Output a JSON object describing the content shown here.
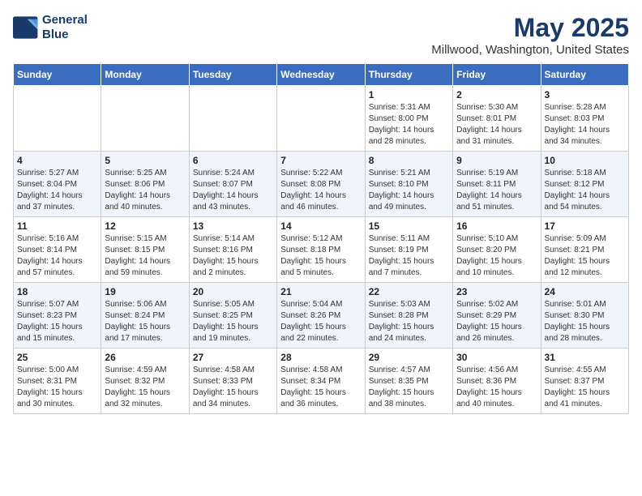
{
  "header": {
    "logo_line1": "General",
    "logo_line2": "Blue",
    "title": "May 2025",
    "subtitle": "Millwood, Washington, United States"
  },
  "weekdays": [
    "Sunday",
    "Monday",
    "Tuesday",
    "Wednesday",
    "Thursday",
    "Friday",
    "Saturday"
  ],
  "weeks": [
    [
      {
        "num": "",
        "detail": ""
      },
      {
        "num": "",
        "detail": ""
      },
      {
        "num": "",
        "detail": ""
      },
      {
        "num": "",
        "detail": ""
      },
      {
        "num": "1",
        "detail": "Sunrise: 5:31 AM\nSunset: 8:00 PM\nDaylight: 14 hours\nand 28 minutes."
      },
      {
        "num": "2",
        "detail": "Sunrise: 5:30 AM\nSunset: 8:01 PM\nDaylight: 14 hours\nand 31 minutes."
      },
      {
        "num": "3",
        "detail": "Sunrise: 5:28 AM\nSunset: 8:03 PM\nDaylight: 14 hours\nand 34 minutes."
      }
    ],
    [
      {
        "num": "4",
        "detail": "Sunrise: 5:27 AM\nSunset: 8:04 PM\nDaylight: 14 hours\nand 37 minutes."
      },
      {
        "num": "5",
        "detail": "Sunrise: 5:25 AM\nSunset: 8:06 PM\nDaylight: 14 hours\nand 40 minutes."
      },
      {
        "num": "6",
        "detail": "Sunrise: 5:24 AM\nSunset: 8:07 PM\nDaylight: 14 hours\nand 43 minutes."
      },
      {
        "num": "7",
        "detail": "Sunrise: 5:22 AM\nSunset: 8:08 PM\nDaylight: 14 hours\nand 46 minutes."
      },
      {
        "num": "8",
        "detail": "Sunrise: 5:21 AM\nSunset: 8:10 PM\nDaylight: 14 hours\nand 49 minutes."
      },
      {
        "num": "9",
        "detail": "Sunrise: 5:19 AM\nSunset: 8:11 PM\nDaylight: 14 hours\nand 51 minutes."
      },
      {
        "num": "10",
        "detail": "Sunrise: 5:18 AM\nSunset: 8:12 PM\nDaylight: 14 hours\nand 54 minutes."
      }
    ],
    [
      {
        "num": "11",
        "detail": "Sunrise: 5:16 AM\nSunset: 8:14 PM\nDaylight: 14 hours\nand 57 minutes."
      },
      {
        "num": "12",
        "detail": "Sunrise: 5:15 AM\nSunset: 8:15 PM\nDaylight: 14 hours\nand 59 minutes."
      },
      {
        "num": "13",
        "detail": "Sunrise: 5:14 AM\nSunset: 8:16 PM\nDaylight: 15 hours\nand 2 minutes."
      },
      {
        "num": "14",
        "detail": "Sunrise: 5:12 AM\nSunset: 8:18 PM\nDaylight: 15 hours\nand 5 minutes."
      },
      {
        "num": "15",
        "detail": "Sunrise: 5:11 AM\nSunset: 8:19 PM\nDaylight: 15 hours\nand 7 minutes."
      },
      {
        "num": "16",
        "detail": "Sunrise: 5:10 AM\nSunset: 8:20 PM\nDaylight: 15 hours\nand 10 minutes."
      },
      {
        "num": "17",
        "detail": "Sunrise: 5:09 AM\nSunset: 8:21 PM\nDaylight: 15 hours\nand 12 minutes."
      }
    ],
    [
      {
        "num": "18",
        "detail": "Sunrise: 5:07 AM\nSunset: 8:23 PM\nDaylight: 15 hours\nand 15 minutes."
      },
      {
        "num": "19",
        "detail": "Sunrise: 5:06 AM\nSunset: 8:24 PM\nDaylight: 15 hours\nand 17 minutes."
      },
      {
        "num": "20",
        "detail": "Sunrise: 5:05 AM\nSunset: 8:25 PM\nDaylight: 15 hours\nand 19 minutes."
      },
      {
        "num": "21",
        "detail": "Sunrise: 5:04 AM\nSunset: 8:26 PM\nDaylight: 15 hours\nand 22 minutes."
      },
      {
        "num": "22",
        "detail": "Sunrise: 5:03 AM\nSunset: 8:28 PM\nDaylight: 15 hours\nand 24 minutes."
      },
      {
        "num": "23",
        "detail": "Sunrise: 5:02 AM\nSunset: 8:29 PM\nDaylight: 15 hours\nand 26 minutes."
      },
      {
        "num": "24",
        "detail": "Sunrise: 5:01 AM\nSunset: 8:30 PM\nDaylight: 15 hours\nand 28 minutes."
      }
    ],
    [
      {
        "num": "25",
        "detail": "Sunrise: 5:00 AM\nSunset: 8:31 PM\nDaylight: 15 hours\nand 30 minutes."
      },
      {
        "num": "26",
        "detail": "Sunrise: 4:59 AM\nSunset: 8:32 PM\nDaylight: 15 hours\nand 32 minutes."
      },
      {
        "num": "27",
        "detail": "Sunrise: 4:58 AM\nSunset: 8:33 PM\nDaylight: 15 hours\nand 34 minutes."
      },
      {
        "num": "28",
        "detail": "Sunrise: 4:58 AM\nSunset: 8:34 PM\nDaylight: 15 hours\nand 36 minutes."
      },
      {
        "num": "29",
        "detail": "Sunrise: 4:57 AM\nSunset: 8:35 PM\nDaylight: 15 hours\nand 38 minutes."
      },
      {
        "num": "30",
        "detail": "Sunrise: 4:56 AM\nSunset: 8:36 PM\nDaylight: 15 hours\nand 40 minutes."
      },
      {
        "num": "31",
        "detail": "Sunrise: 4:55 AM\nSunset: 8:37 PM\nDaylight: 15 hours\nand 41 minutes."
      }
    ]
  ]
}
